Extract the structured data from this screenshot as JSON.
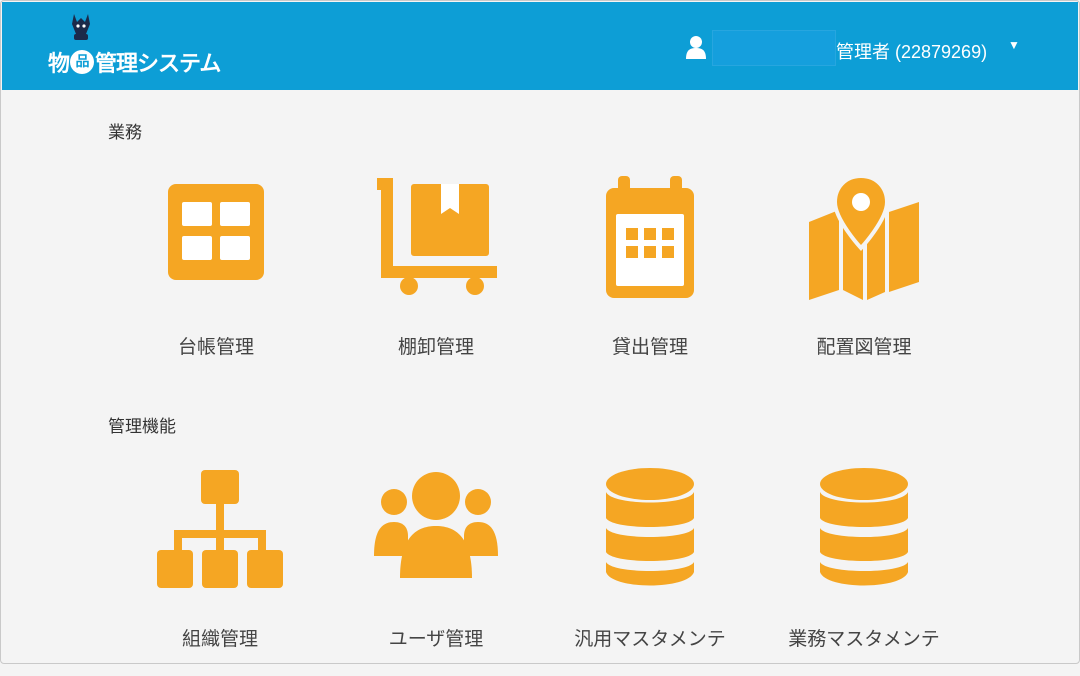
{
  "colors": {
    "header": "#0d9ed6",
    "accent": "#f5a623",
    "background": "#f4f4f4"
  },
  "header": {
    "logo_text_pre": "物",
    "logo_badge": "品",
    "logo_text_post": "管理システム",
    "user_role": "管理者 (22879269)",
    "user_icon": "user-icon",
    "caret_icon": "caret-down-icon"
  },
  "sections": [
    {
      "title": "業務",
      "tiles": [
        {
          "label": "台帳管理",
          "icon": "ledger-grid-icon"
        },
        {
          "label": "棚卸管理",
          "icon": "hand-truck-box-icon"
        },
        {
          "label": "貸出管理",
          "icon": "calendar-icon"
        },
        {
          "label": "配置図管理",
          "icon": "map-pin-icon"
        }
      ]
    },
    {
      "title": "管理機能",
      "tiles": [
        {
          "label": "組織管理",
          "icon": "org-chart-icon"
        },
        {
          "label": "ユーザ管理",
          "icon": "users-group-icon"
        },
        {
          "label": "汎用マスタメンテ",
          "icon": "database-icon"
        },
        {
          "label": "業務マスタメンテ",
          "icon": "database-icon"
        }
      ]
    }
  ]
}
